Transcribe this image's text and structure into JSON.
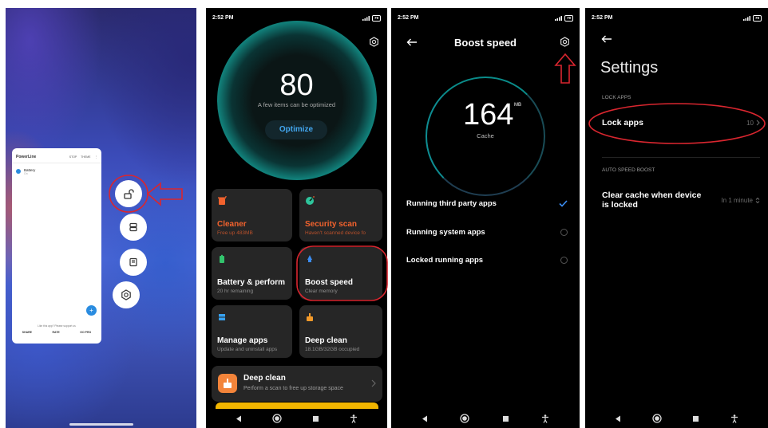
{
  "panel1": {
    "app_card": {
      "title": "PowerLine",
      "actions": [
        "STOP",
        "THEME",
        "⋮"
      ],
      "item_title": "Battery",
      "item_sub": "On",
      "footer_note": "Like this app? Please support us",
      "footer_buttons": [
        "SHARE",
        "RATE",
        "GO PRO"
      ]
    },
    "circle_buttons": [
      "unlock-icon",
      "split-screen-icon",
      "window-icon",
      "settings-icon"
    ]
  },
  "panel2": {
    "time": "2:52 PM",
    "battery": "79",
    "score": "80",
    "score_sub": "A few items can be optimized",
    "optimize_label": "Optimize",
    "tiles": [
      {
        "title": "Cleaner",
        "sub": "Free up 483MB",
        "icon_color": "#f2622d"
      },
      {
        "title": "Security scan",
        "sub": "Haven't scanned device fo",
        "icon_color": "#2ec49b"
      },
      {
        "title": "Battery & perform",
        "sub": "20 hr  remaining",
        "icon_color": "#32c36c"
      },
      {
        "title": "Boost speed",
        "sub": "Clear memory",
        "icon_color": "#3b8df2"
      },
      {
        "title": "Manage apps",
        "sub": "Update and uninstall apps",
        "icon_color": "#37a0ef"
      },
      {
        "title": "Deep clean",
        "sub": "18.1GB/32GB occupied",
        "icon_color": "#f39a2a"
      }
    ],
    "wide_tile": {
      "title": "Deep clean",
      "sub": "Perform a scan to free up storage space"
    }
  },
  "panel3": {
    "time": "2:52 PM",
    "battery": "79",
    "title": "Boost speed",
    "value": "164",
    "unit": "MB",
    "value_label": "Cache",
    "options": [
      {
        "label": "Running third party apps",
        "checked": true
      },
      {
        "label": "Running system apps",
        "checked": false
      },
      {
        "label": "Locked running apps",
        "checked": false
      }
    ]
  },
  "panel4": {
    "time": "2:52 PM",
    "battery": "79",
    "title": "Settings",
    "section_lock": "LOCK APPS",
    "lock_apps_label": "Lock apps",
    "lock_apps_value": "10",
    "section_boost": "AUTO SPEED BOOST",
    "clear_cache_label_1": "Clear cache when device",
    "clear_cache_label_2": "is locked",
    "clear_cache_value": "In 1 minute"
  },
  "colors": {
    "annotation_red": "#d9262f",
    "accent_blue": "#3b8df2",
    "teal_glow": "#11807a"
  }
}
